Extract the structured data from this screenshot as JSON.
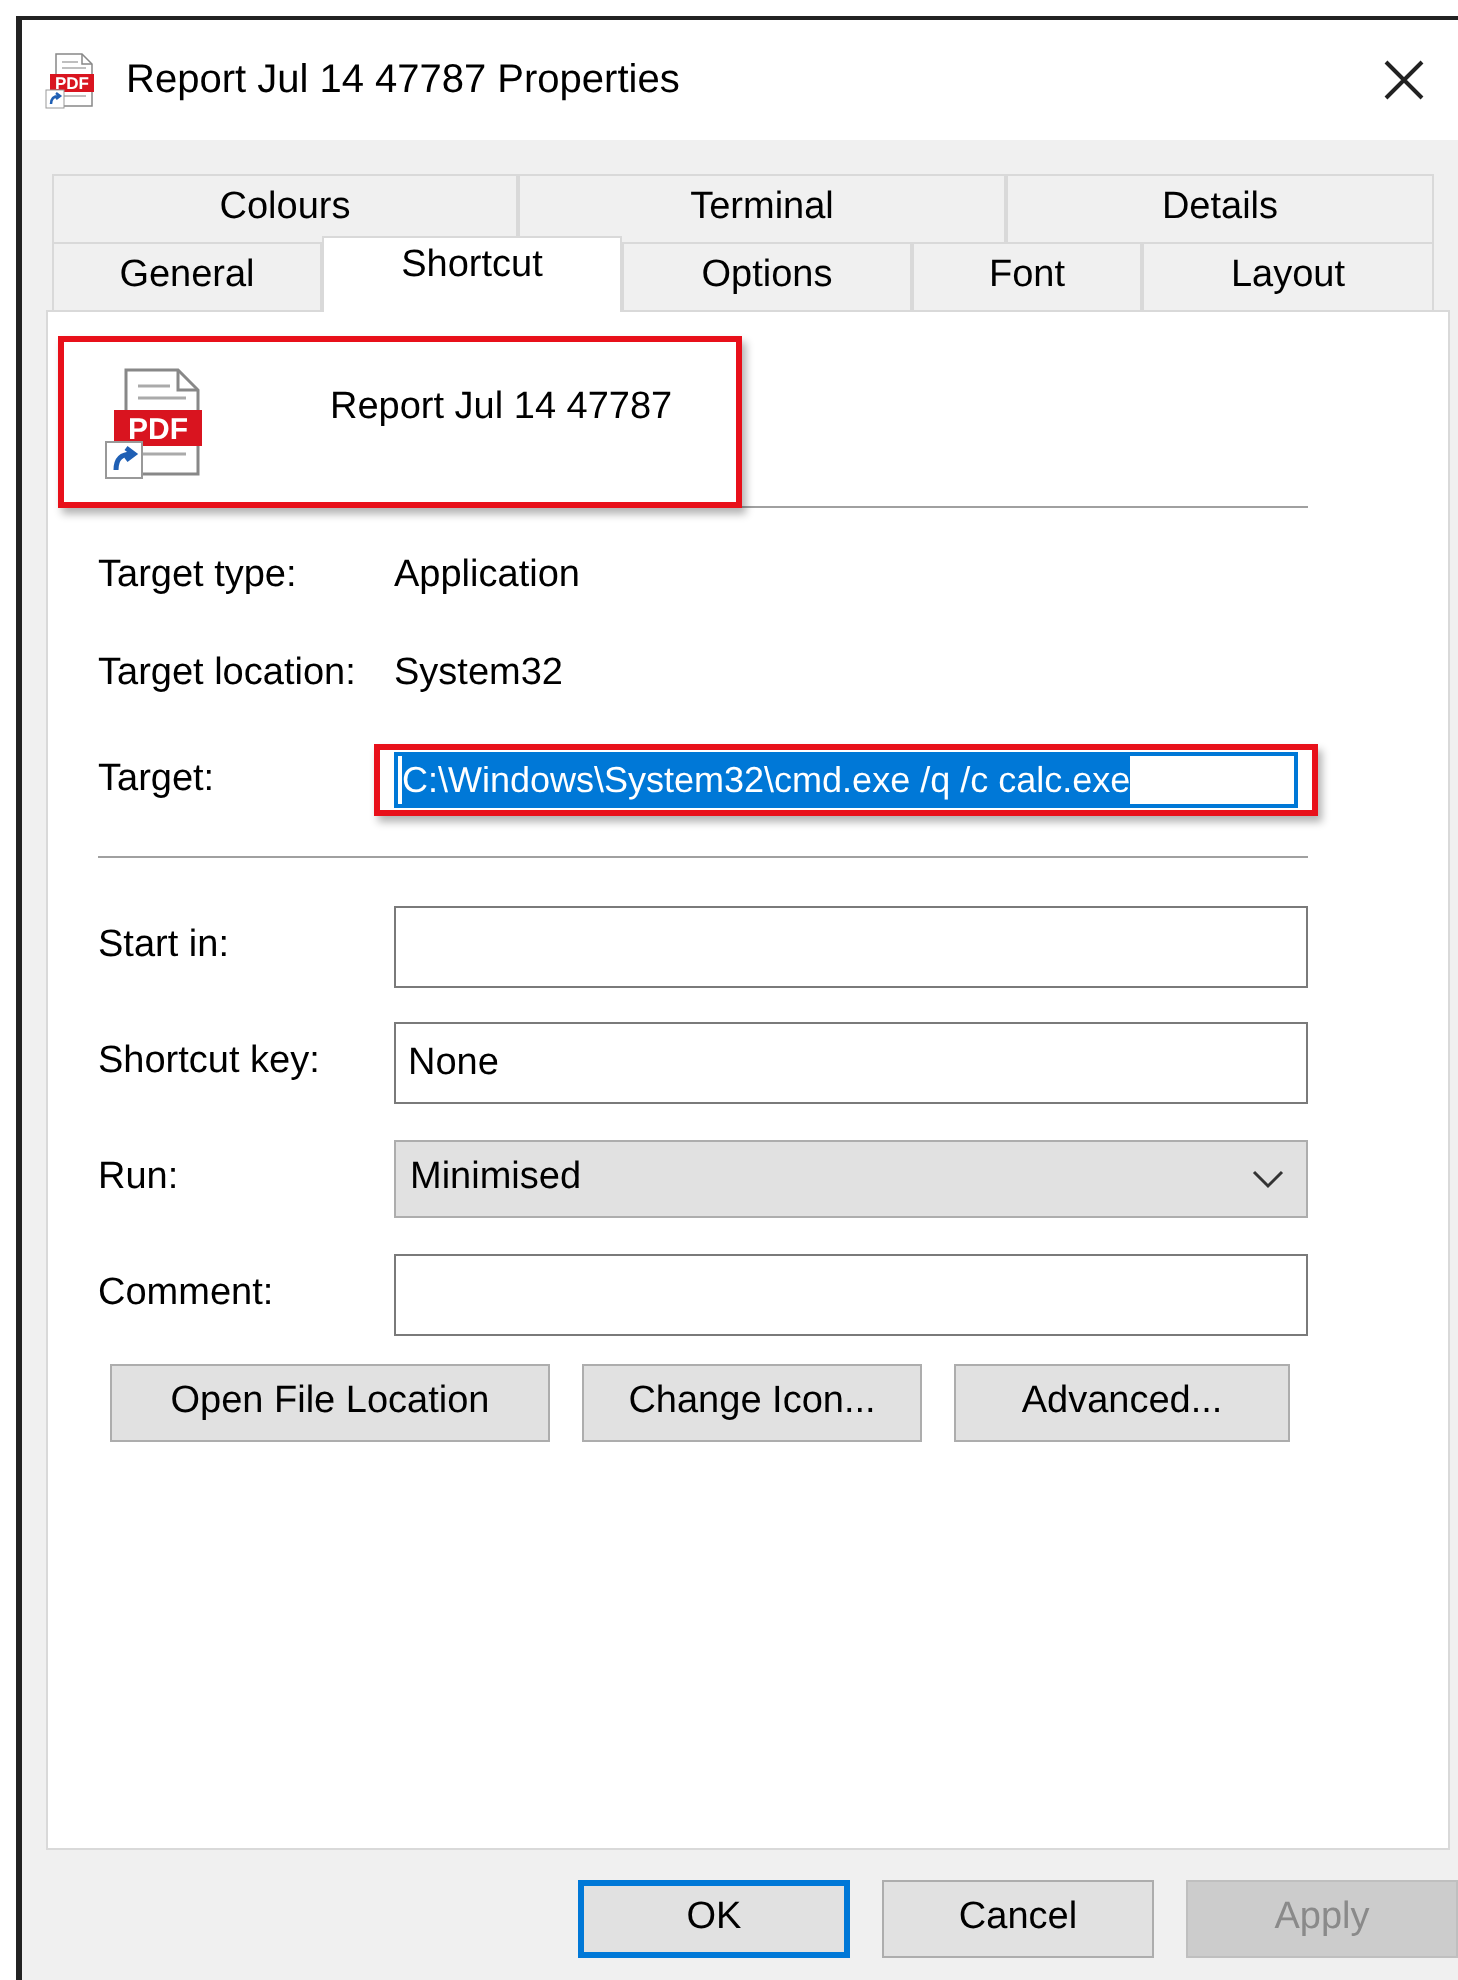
{
  "window": {
    "title": "Report Jul 14 47787 Properties",
    "icon_badge": "PDF"
  },
  "tab_rows": [
    [
      {
        "label": "Colours",
        "selected": false
      },
      {
        "label": "Terminal",
        "selected": false
      },
      {
        "label": "Details",
        "selected": false
      }
    ],
    [
      {
        "label": "General",
        "selected": false
      },
      {
        "label": "Shortcut",
        "selected": true
      },
      {
        "label": "Options",
        "selected": false
      },
      {
        "label": "Font",
        "selected": false
      },
      {
        "label": "Layout",
        "selected": false
      }
    ]
  ],
  "header": {
    "name": "Report Jul 14 47787",
    "icon_badge": "PDF",
    "highlighted": true
  },
  "info": [
    {
      "label": "Target type:",
      "value": "Application"
    },
    {
      "label": "Target location:",
      "value": "System32"
    }
  ],
  "target": {
    "label": "Target:",
    "value": "C:\\Windows\\System32\\cmd.exe /q /c calc.exe",
    "text_selected": true,
    "highlighted": true
  },
  "fields": [
    {
      "kind": "text",
      "label": "Start in:"
    },
    {
      "kind": "text",
      "label": "Shortcut key:",
      "value": "None"
    },
    {
      "kind": "select",
      "label": "Run:",
      "value": "Minimised"
    },
    {
      "kind": "text",
      "label": "Comment:"
    }
  ],
  "actions": [
    "Open File Location",
    "Change Icon...",
    "Advanced..."
  ],
  "buttons": [
    {
      "label": "OK",
      "default": true,
      "disabled": false
    },
    {
      "label": "Cancel",
      "default": false,
      "disabled": false
    },
    {
      "label": "Apply",
      "default": false,
      "disabled": true
    }
  ]
}
